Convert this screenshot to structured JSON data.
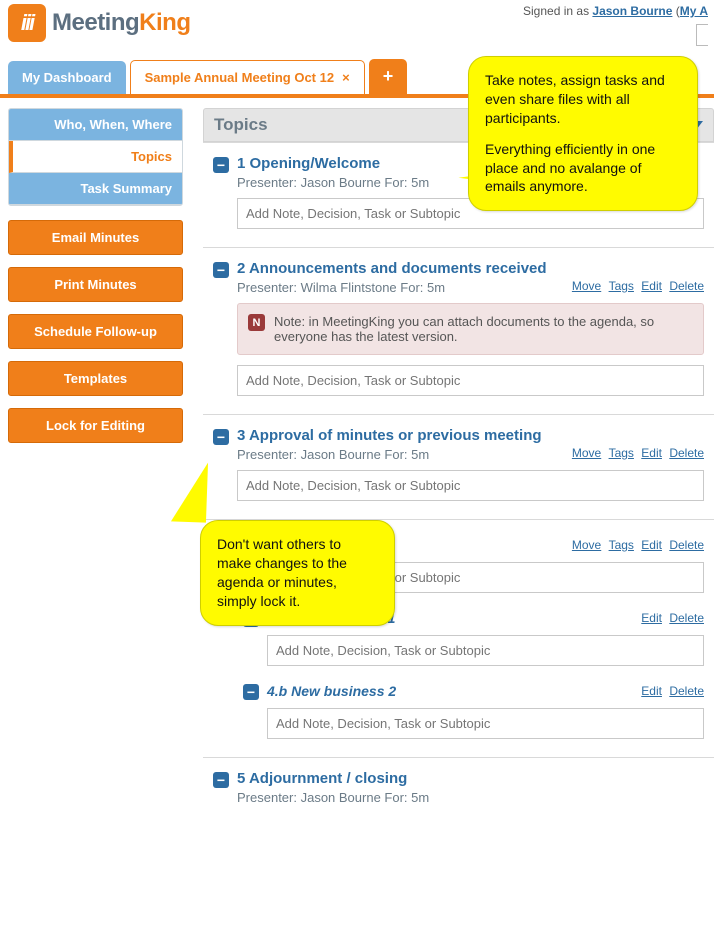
{
  "brand": {
    "meeting": "Meeting",
    "king": "King"
  },
  "header": {
    "signed_in_prefix": "Signed in as ",
    "user": "Jason Bourne",
    "my_account": "My A"
  },
  "tabs": {
    "dashboard": "My Dashboard",
    "active": "Sample Annual Meeting Oct 12",
    "close": "×",
    "plus": "+"
  },
  "sidebar": {
    "nav": {
      "who": "Who, When, Where",
      "topics": "Topics",
      "summary": "Task Summary"
    },
    "buttons": {
      "email": "Email Minutes",
      "print": "Print Minutes",
      "followup": "Schedule Follow-up",
      "templates": "Templates",
      "lock": "Lock for Editing"
    }
  },
  "panel_title": "Topics",
  "input_placeholder": "Add Note, Decision, Task or Subtopic",
  "link": {
    "move": "Move",
    "tags": "Tags",
    "edit": "Edit",
    "delete": "Delete"
  },
  "topics": [
    {
      "num": "1",
      "title": "Opening/Welcome",
      "presenter": "Presenter: Jason Bourne  For: 5m"
    },
    {
      "num": "2",
      "title": "Announcements and documents received",
      "presenter": "Presenter: Wilma Flintstone  For: 5m",
      "note": "Note: in MeetingKing you can attach documents to the agenda, so everyone has the latest version."
    },
    {
      "num": "3",
      "title": "Approval of minutes or previous meeting",
      "presenter": "Presenter: Jason Bourne  For: 5m"
    },
    {
      "num": "4",
      "title": "",
      "presenter": "",
      "subs": [
        {
          "num": "4.a",
          "title": "New business 1"
        },
        {
          "num": "4.b",
          "title": "New business 2"
        }
      ]
    },
    {
      "num": "5",
      "title": "Adjournment / closing",
      "presenter": "Presenter: Jason Bourne  For: 5m"
    }
  ],
  "bubbles": {
    "b1a": "Take notes, assign tasks and even share files with all participants.",
    "b1b": "Everything efficiently in one place and no avalange of emails anymore.",
    "b2": "Don't want others to make changes to the agenda or minutes, simply lock it."
  }
}
